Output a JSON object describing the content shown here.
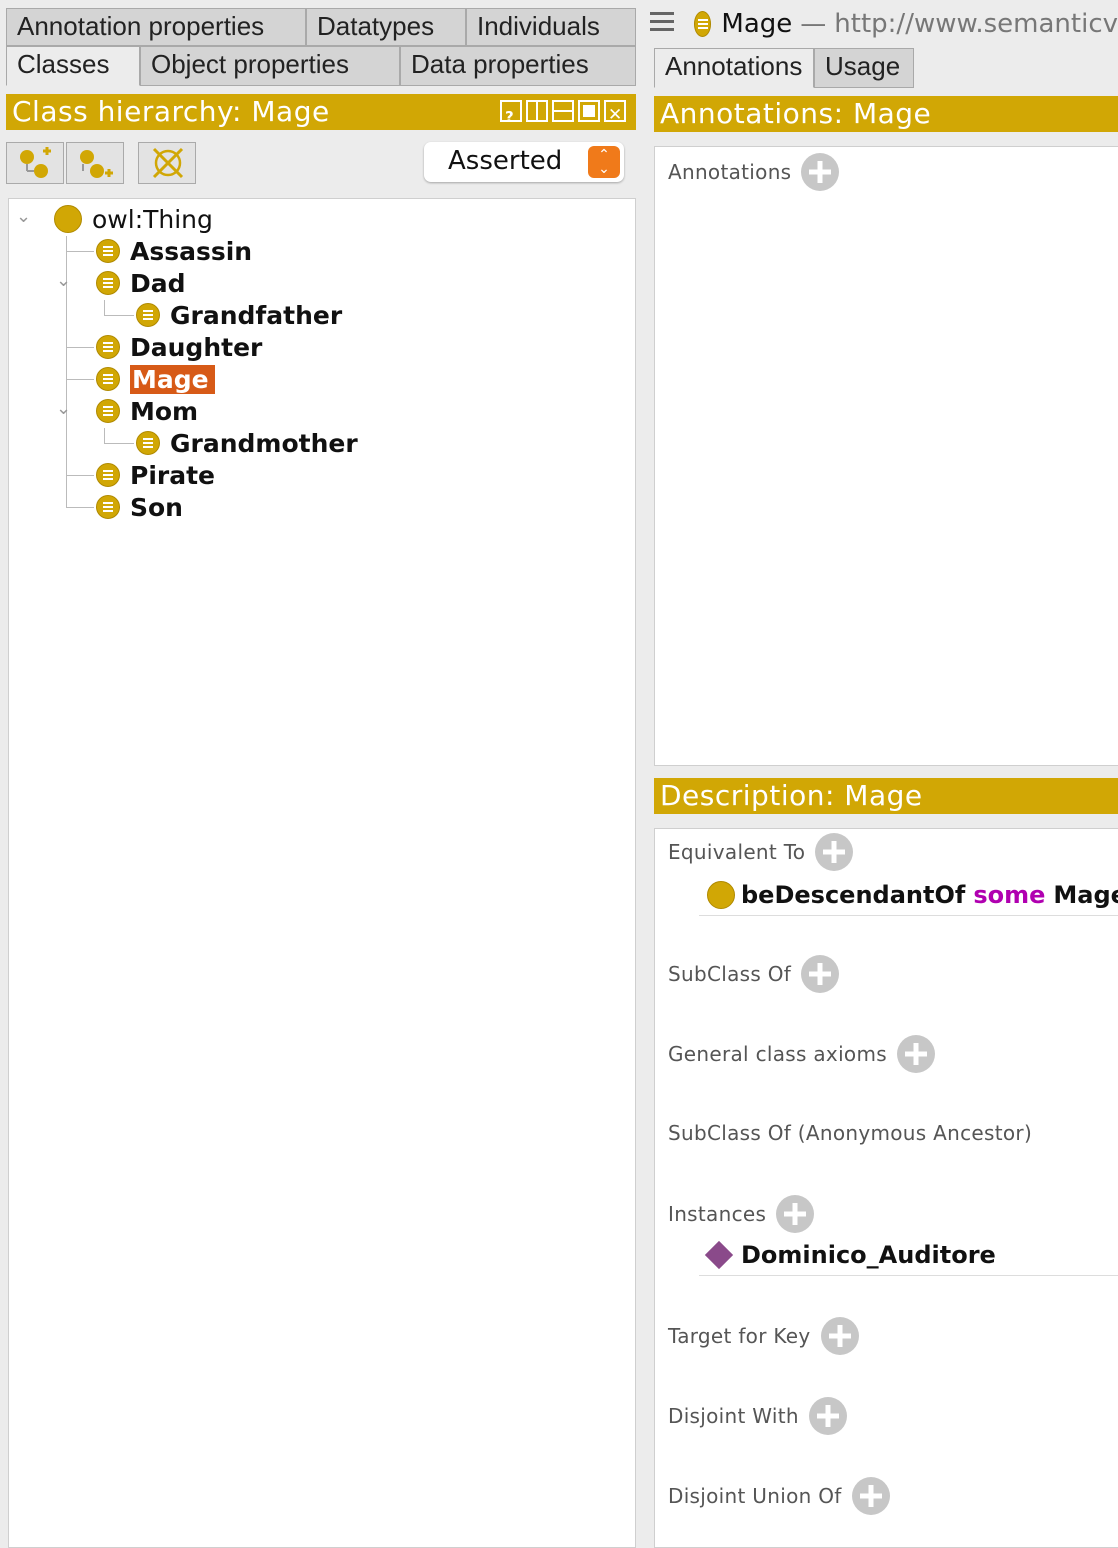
{
  "left_tabs": {
    "row1": [
      "Annotation properties",
      "Datatypes",
      "Individuals"
    ],
    "row2": [
      "Classes",
      "Object properties",
      "Data properties"
    ],
    "active": "Classes"
  },
  "class_hierarchy": {
    "title": "Class hierarchy: Mage",
    "mode_select": "Asserted",
    "root": "owl:Thing",
    "items": [
      "Assassin",
      "Dad",
      "Grandfather",
      "Daughter",
      "Mage",
      "Mom",
      "Grandmother",
      "Pirate",
      "Son"
    ],
    "selected": "Mage",
    "colors": {
      "header": "#d1a705",
      "selected_bg": "#d75a17",
      "class_icon": "#d1a705"
    }
  },
  "entity_header": {
    "name": "Mage",
    "separator": "—",
    "iri": "http://www.semanticv"
  },
  "right_tabs": [
    "Annotations",
    "Usage"
  ],
  "annotations_panel": {
    "title": "Annotations: Mage",
    "section_label": "Annotations"
  },
  "description_panel": {
    "title": "Description: Mage",
    "equivalent_to": {
      "label": "Equivalent To",
      "expr_property": "beDescendantOf",
      "expr_keyword": "some",
      "expr_class": "Mage"
    },
    "subclass_of": "SubClass Of",
    "general_class_axioms": "General class axioms",
    "subclass_of_anon": "SubClass Of (Anonymous Ancestor)",
    "instances": {
      "label": "Instances",
      "value": "Dominico_Auditore"
    },
    "target_for_key": "Target for Key",
    "disjoint_with": "Disjoint With",
    "disjoint_union_of": "Disjoint Union Of",
    "colors": {
      "keyword": "#b000b0",
      "individual_icon": "#8a4a8a"
    }
  }
}
